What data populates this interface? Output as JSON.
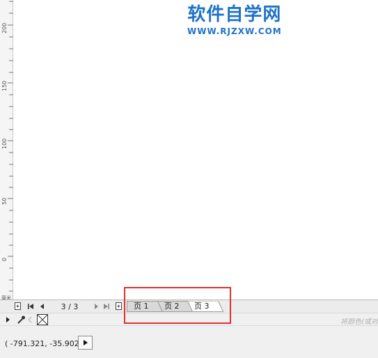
{
  "ruler": {
    "labels": [
      "200",
      "150",
      "100",
      "50",
      "0"
    ],
    "unit": "毫米"
  },
  "watermark": {
    "title": "软件自学网",
    "url": "WWW.RJZXW.COM"
  },
  "navigator": {
    "page_counter": "3 / 3",
    "tabs": [
      {
        "label": "页 1",
        "active": false
      },
      {
        "label": "页 2",
        "active": false
      },
      {
        "label": "页 3",
        "active": true
      }
    ]
  },
  "colorbar": {
    "hint": "将颜色(或对"
  },
  "status": {
    "coordinates": "( -791.321, -35.902 )"
  },
  "colors": {
    "watermark": "#1e73c8",
    "highlight": "#e03030"
  }
}
